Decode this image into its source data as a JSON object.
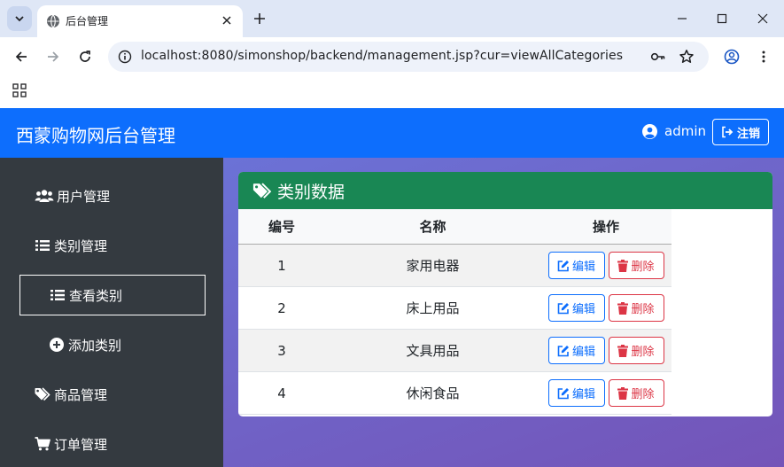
{
  "browser": {
    "tab_title": "后台管理",
    "url": "localhost:8080/simonshop/backend/management.jsp?cur=viewAllCategories"
  },
  "header": {
    "brand": "西蒙购物网后台管理",
    "username": "admin",
    "logout_label": "注销"
  },
  "sidebar": {
    "items": [
      {
        "label": "用户管理",
        "icon": "users-icon"
      },
      {
        "label": "类别管理",
        "icon": "list-icon"
      },
      {
        "label": "查看类别",
        "icon": "list-icon",
        "active": true
      },
      {
        "label": "添加类别",
        "icon": "plus-circle-icon"
      },
      {
        "label": "商品管理",
        "icon": "tags-icon"
      },
      {
        "label": "订单管理",
        "icon": "cart-icon"
      }
    ]
  },
  "card": {
    "title": "类别数据",
    "icon": "tags-icon",
    "color": "#198754"
  },
  "table": {
    "columns": [
      "编号",
      "名称",
      "操作"
    ],
    "edit_label": "编辑",
    "delete_label": "删除",
    "rows": [
      {
        "id": "1",
        "name": "家用电器"
      },
      {
        "id": "2",
        "name": "床上用品"
      },
      {
        "id": "3",
        "name": "文具用品"
      },
      {
        "id": "4",
        "name": "休闲食品"
      }
    ]
  },
  "colors": {
    "navbar": "#0d6efd",
    "sidebar": "#343a40",
    "edit": "#0d6efd",
    "delete": "#dc3545"
  }
}
